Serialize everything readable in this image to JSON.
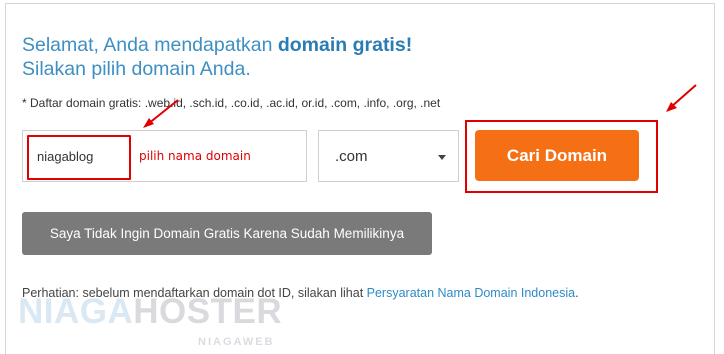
{
  "heading": {
    "line1_prefix": "Selamat, Anda mendapatkan ",
    "line1_bold": "domain gratis!",
    "line2": "Silakan pilih domain Anda."
  },
  "note": "* Daftar domain gratis: .web.id, .sch.id, .co.id, .ac.id, or.id, .com, .info, .org, .net",
  "domain_input": {
    "value": "niagablog"
  },
  "annotation": "pilih nama domain",
  "tld_select": {
    "selected": ".com"
  },
  "search_button": "Cari Domain",
  "decline_button": "Saya Tidak Ingin Domain Gratis Karena Sudah Memilikinya",
  "notice": {
    "text": "Perhatian: sebelum mendaftarkan domain dot ID, silakan lihat ",
    "link": "Persyaratan Nama Domain Indonesia",
    "end": "."
  },
  "watermark": {
    "brand_part1": "NIAGA",
    "brand_part2": "HOSTER",
    "sub": "NIAGAWEB"
  },
  "colors": {
    "accent_blue": "#3d8fc4",
    "button_orange": "#f57014",
    "annotation_red": "#e00000",
    "button_gray": "#7a7a7a"
  }
}
